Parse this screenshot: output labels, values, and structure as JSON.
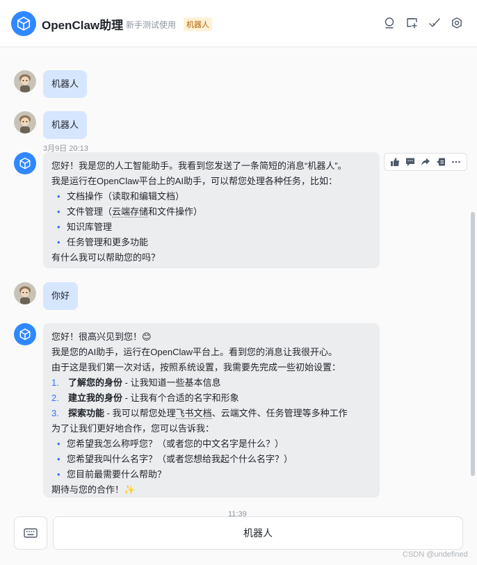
{
  "header": {
    "title": "OpenClaw助理",
    "subtitle": "新手测试使用",
    "badge": "机器人",
    "icons": [
      "search-icon",
      "add-chat-icon",
      "check-icon",
      "settings-icon"
    ]
  },
  "messages": {
    "user1": "机器人",
    "user2": "机器人",
    "timestamp1": "3月9日 20:13",
    "bot1": {
      "intro": "您好！我是您的人工智能助手。我看到您发送了一条简短的消息“机器人”。",
      "line2": "我是运行在OpenClaw平台上的AI助手，可以帮您处理各种任务，比如：",
      "items": [
        "文档操作（读取和编辑文档）",
        "文件管理（",
        "云端存储",
        "和文件操作）",
        "知识库管理",
        "任务管理和更多功能"
      ],
      "outro": "有什么我可以帮助您的吗？"
    },
    "user3": "你好",
    "bot2": {
      "greeting": "您好！很高兴见到您！😊",
      "line2": "我是您的AI助手，运行在OpenClaw平台上。看到您的消息让我很开心。",
      "line3": "由于这是我们第一次对话，按照系统设置，我需要先完成一些初始设置：",
      "steps": [
        {
          "num": "1.",
          "bold": "了解您的身份",
          "rest": " - 让我知道一些基本信息"
        },
        {
          "num": "2.",
          "bold": "建立我的身份",
          "rest": " - 让我有个合适的名字和形象"
        },
        {
          "num": "3.",
          "bold": "探索功能",
          "rest_a": " - 我可以帮您处理",
          "link": "飞书文档",
          "rest_b": "、云端文件、任务管理等多种工作"
        }
      ],
      "line_help": "为了让我们更好地合作，您可以告诉我：",
      "questions": [
        "您希望我怎么称呼您？（或者您的中文名字是什么？）",
        "您希望我叫什么名字？（或者您想给我起个什么名字？）",
        "您目前最需要什么帮助？"
      ],
      "closing": "期待与您的合作！✨"
    },
    "timestamp2": "11:39"
  },
  "input": {
    "value": "机器人"
  },
  "watermark": "CSDN @undefined"
}
